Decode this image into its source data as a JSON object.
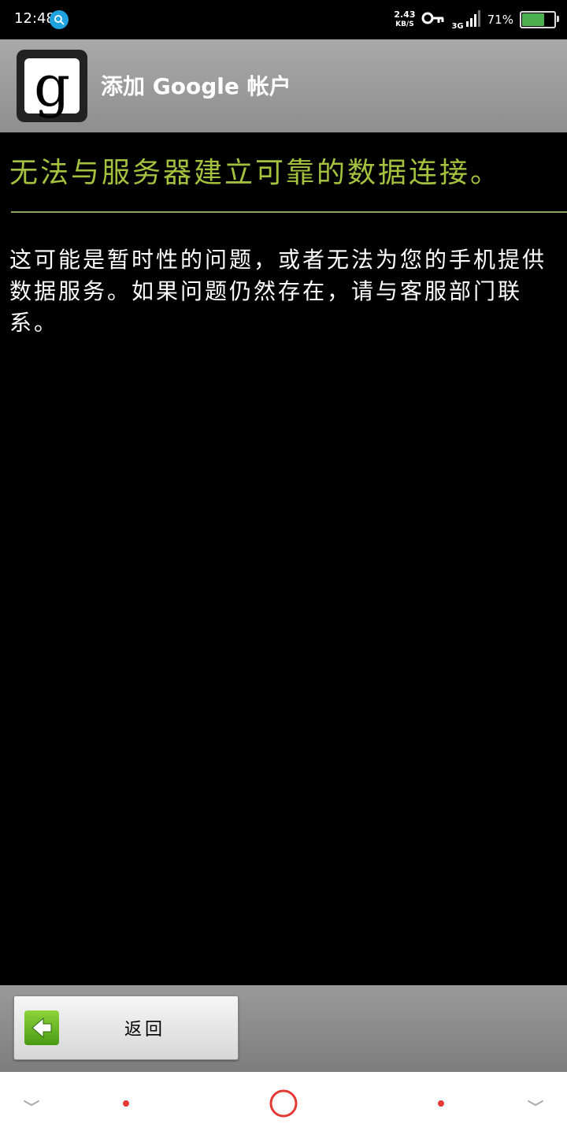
{
  "status_bar": {
    "time": "12:48",
    "net_speed_value": "2.43",
    "net_speed_unit": "KB/S",
    "network_type": "3G",
    "battery_percent": "71",
    "battery_level": 0.71,
    "icons": [
      "search-icon",
      "vpn-key-icon",
      "signal-icon",
      "battery-icon"
    ]
  },
  "header": {
    "title": "添加 Google 帐户",
    "logo_letter": "g"
  },
  "error": {
    "title": "无法与服务器建立可靠的数据连接。",
    "message": "这可能是暂时性的问题，或者无法为您的手机提供数据服务。如果问题仍然存在，请与客服部门联系。"
  },
  "footer": {
    "back_label": "返回"
  },
  "colors": {
    "error_title": "#a5c23f",
    "nav_accent": "#e53935"
  }
}
